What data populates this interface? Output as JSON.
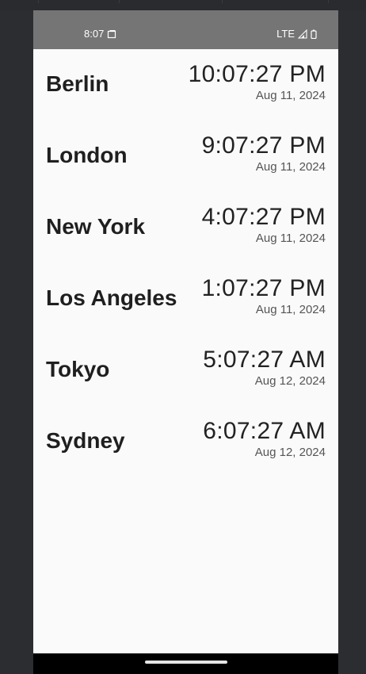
{
  "status_bar": {
    "time": "8:07",
    "network": "LTE",
    "icons": [
      "screenshot-icon",
      "signal-icon",
      "battery-icon"
    ]
  },
  "clocks": [
    {
      "city": "Berlin",
      "time": "10:07:27 PM",
      "date": "Aug 11, 2024"
    },
    {
      "city": "London",
      "time": "9:07:27 PM",
      "date": "Aug 11, 2024"
    },
    {
      "city": "New York",
      "time": "4:07:27 PM",
      "date": "Aug 11, 2024"
    },
    {
      "city": "Los Angeles",
      "time": "1:07:27 PM",
      "date": "Aug 11, 2024"
    },
    {
      "city": "Tokyo",
      "time": "5:07:27 AM",
      "date": "Aug 12, 2024"
    },
    {
      "city": "Sydney",
      "time": "6:07:27 AM",
      "date": "Aug 12, 2024"
    }
  ],
  "colors": {
    "status_bar": "#757575",
    "background": "#fafafa",
    "text": "#1f1f1f"
  }
}
